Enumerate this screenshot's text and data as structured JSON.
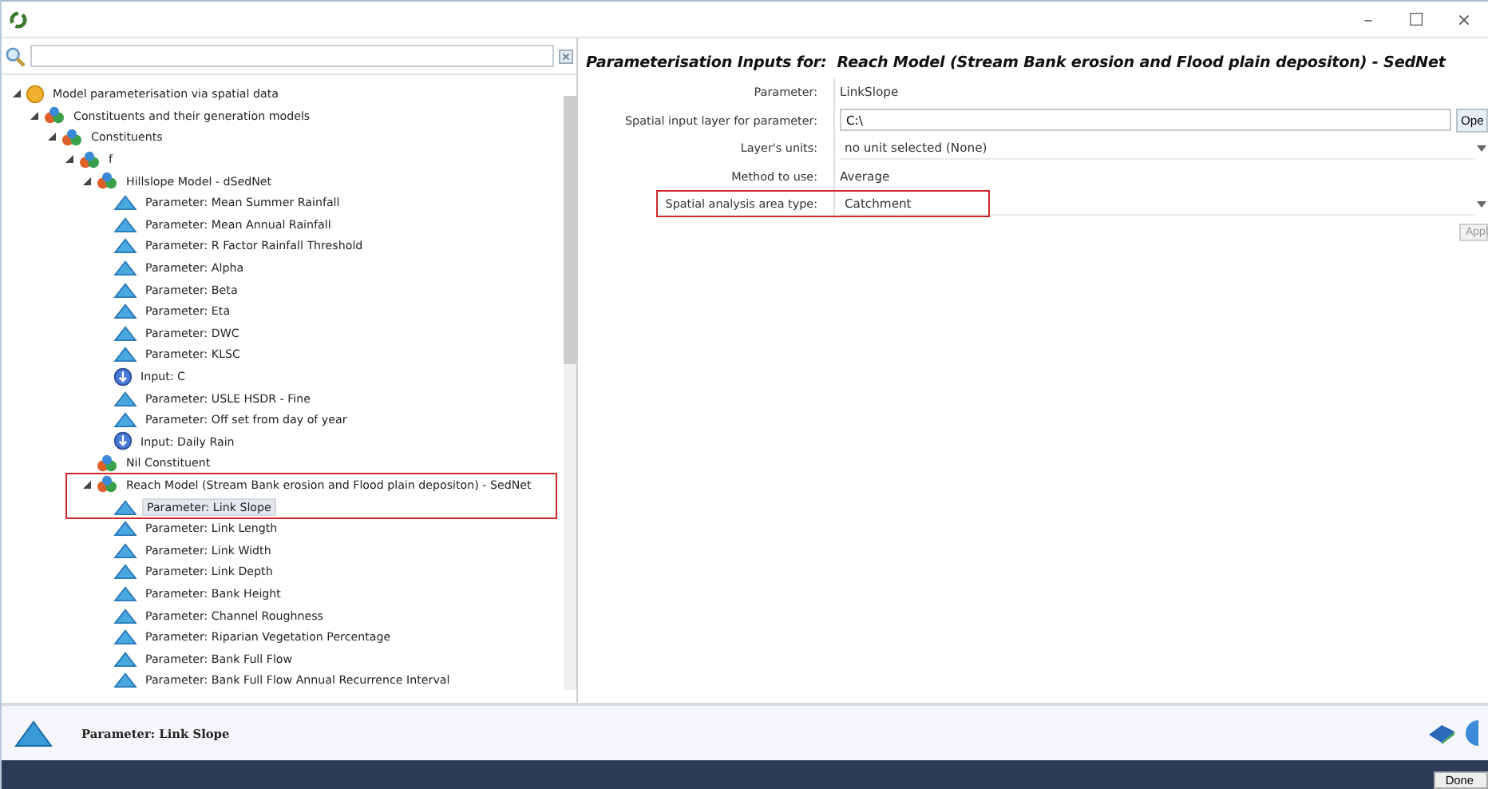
{
  "window": {
    "controls": [
      "–",
      "☐",
      "×"
    ]
  },
  "tree": [
    {
      "label": "Model parameterisation via spatial data",
      "kind": "folder",
      "expanded": true,
      "selected": false,
      "children": [
        {
          "label": "Constituents and their generation models",
          "kind": "model",
          "expanded": true,
          "selected": false,
          "children": [
            {
              "label": "Constituents",
              "kind": "model",
              "expanded": true,
              "selected": false,
              "children": [
                {
                  "label": "f",
                  "kind": "model",
                  "expanded": true,
                  "selected": false,
                  "children": [
                    {
                      "label": "Hillslope Model - dSedNet",
                      "kind": "model",
                      "expanded": true,
                      "selected": false,
                      "children": [
                        {
                          "label": "Parameter: Mean Summer Rainfall",
                          "kind": "parameter",
                          "selected": false
                        },
                        {
                          "label": "Parameter: Mean Annual Rainfall",
                          "kind": "parameter",
                          "selected": false
                        },
                        {
                          "label": "Parameter: R Factor Rainfall Threshold",
                          "kind": "parameter",
                          "selected": false
                        },
                        {
                          "label": "Parameter: Alpha",
                          "kind": "parameter",
                          "selected": false
                        },
                        {
                          "label": "Parameter: Beta",
                          "kind": "parameter",
                          "selected": false
                        },
                        {
                          "label": "Parameter: Eta",
                          "kind": "parameter",
                          "selected": false
                        },
                        {
                          "label": "Parameter: DWC",
                          "kind": "parameter",
                          "selected": false
                        },
                        {
                          "label": "Parameter: KLSC",
                          "kind": "parameter",
                          "selected": false
                        },
                        {
                          "label": "Input: C",
                          "kind": "input",
                          "selected": false
                        },
                        {
                          "label": "Parameter: USLE HSDR - Fine",
                          "kind": "parameter",
                          "selected": false
                        },
                        {
                          "label": "Parameter: Off set from day of year",
                          "kind": "parameter",
                          "selected": false
                        },
                        {
                          "label": "Input: Daily Rain",
                          "kind": "input",
                          "selected": false
                        }
                      ]
                    },
                    {
                      "label": "Nil Constituent",
                      "kind": "model",
                      "selected": false
                    },
                    {
                      "label": "Reach Model (Stream Bank erosion and Flood plain depositon) - SedNet",
                      "kind": "model",
                      "expanded": true,
                      "selected": false,
                      "highlighted": true,
                      "children": [
                        {
                          "label": "Parameter: Link Slope",
                          "kind": "parameter",
                          "selected": true,
                          "highlighted": true
                        },
                        {
                          "label": "Parameter: Link Length",
                          "kind": "parameter",
                          "selected": false
                        },
                        {
                          "label": "Parameter: Link Width",
                          "kind": "parameter",
                          "selected": false
                        },
                        {
                          "label": "Parameter: Link Depth",
                          "kind": "parameter",
                          "selected": false
                        },
                        {
                          "label": "Parameter: Bank Height",
                          "kind": "parameter",
                          "selected": false
                        },
                        {
                          "label": "Parameter: Channel Roughness",
                          "kind": "parameter",
                          "selected": false
                        },
                        {
                          "label": "Parameter: Riparian Vegetation Percentage",
                          "kind": "parameter",
                          "selected": false
                        },
                        {
                          "label": "Parameter: Bank Full Flow",
                          "kind": "parameter",
                          "selected": false
                        },
                        {
                          "label": "Parameter: Bank Full Flow Annual Recurrence Interval",
                          "kind": "parameter",
                          "selected": false
                        }
                      ]
                    }
                  ]
                }
              ]
            }
          ]
        }
      ]
    }
  ],
  "panel": {
    "title_prefix": "Parameterisation Inputs for:",
    "title": "Reach Model (Stream Bank erosion and Flood plain depositon) - SedNet",
    "fields": [
      {
        "label": "Parameter:",
        "kind": "text",
        "value": "LinkSlope"
      },
      {
        "label": "Spatial input layer for parameter:",
        "kind": "input",
        "value": "C:\\",
        "button": "Ope"
      },
      {
        "label": "Layer's units:",
        "kind": "dropdown",
        "value": "no unit selected (None)"
      },
      {
        "label": "Method to use:",
        "kind": "text",
        "value": "Average"
      },
      {
        "label": "Spatial analysis area type:",
        "kind": "dropdown",
        "value": "Catchment",
        "highlighted": true
      }
    ],
    "apply_button": "Appl"
  },
  "status": {
    "label": "Parameter: Link Slope"
  },
  "done_button": "Done"
}
